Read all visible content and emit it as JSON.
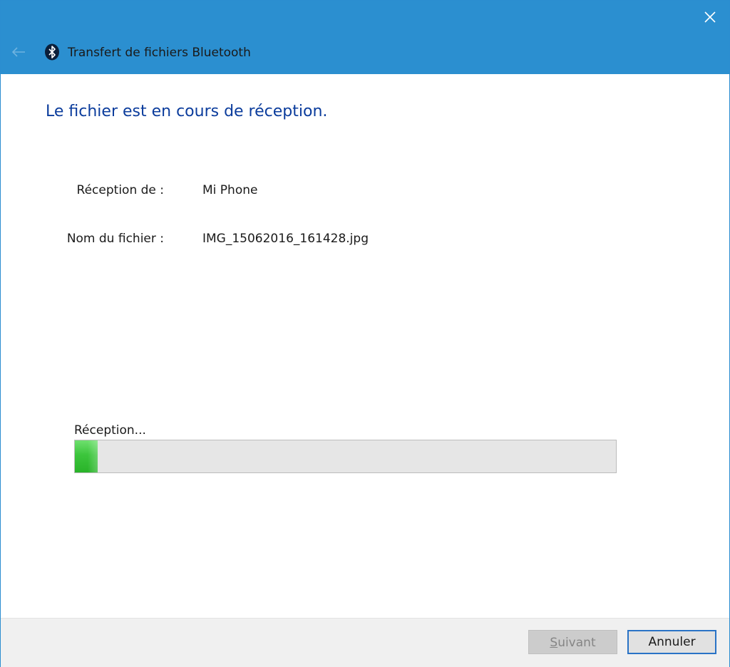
{
  "window": {
    "title": "Transfert de fichiers Bluetooth",
    "close_glyph": "✕",
    "back_glyph": "←",
    "accent_color": "#2b8fd0"
  },
  "icons": {
    "title_icon": "bluetooth-icon",
    "back": "back-arrow-icon",
    "close": "close-icon"
  },
  "main": {
    "heading": "Le fichier est en cours de réception.",
    "info": [
      {
        "label": "Réception de :",
        "value": "Mi Phone"
      },
      {
        "label": "Nom du fichier :",
        "value": "IMG_15062016_161428.jpg"
      }
    ]
  },
  "progress": {
    "label": "Réception...",
    "percent": 4.2,
    "fill_color": "#3cc53c"
  },
  "footer": {
    "next_accel": "S",
    "next_rest": "uivant",
    "next_enabled": false,
    "cancel_label": "Annuler"
  }
}
